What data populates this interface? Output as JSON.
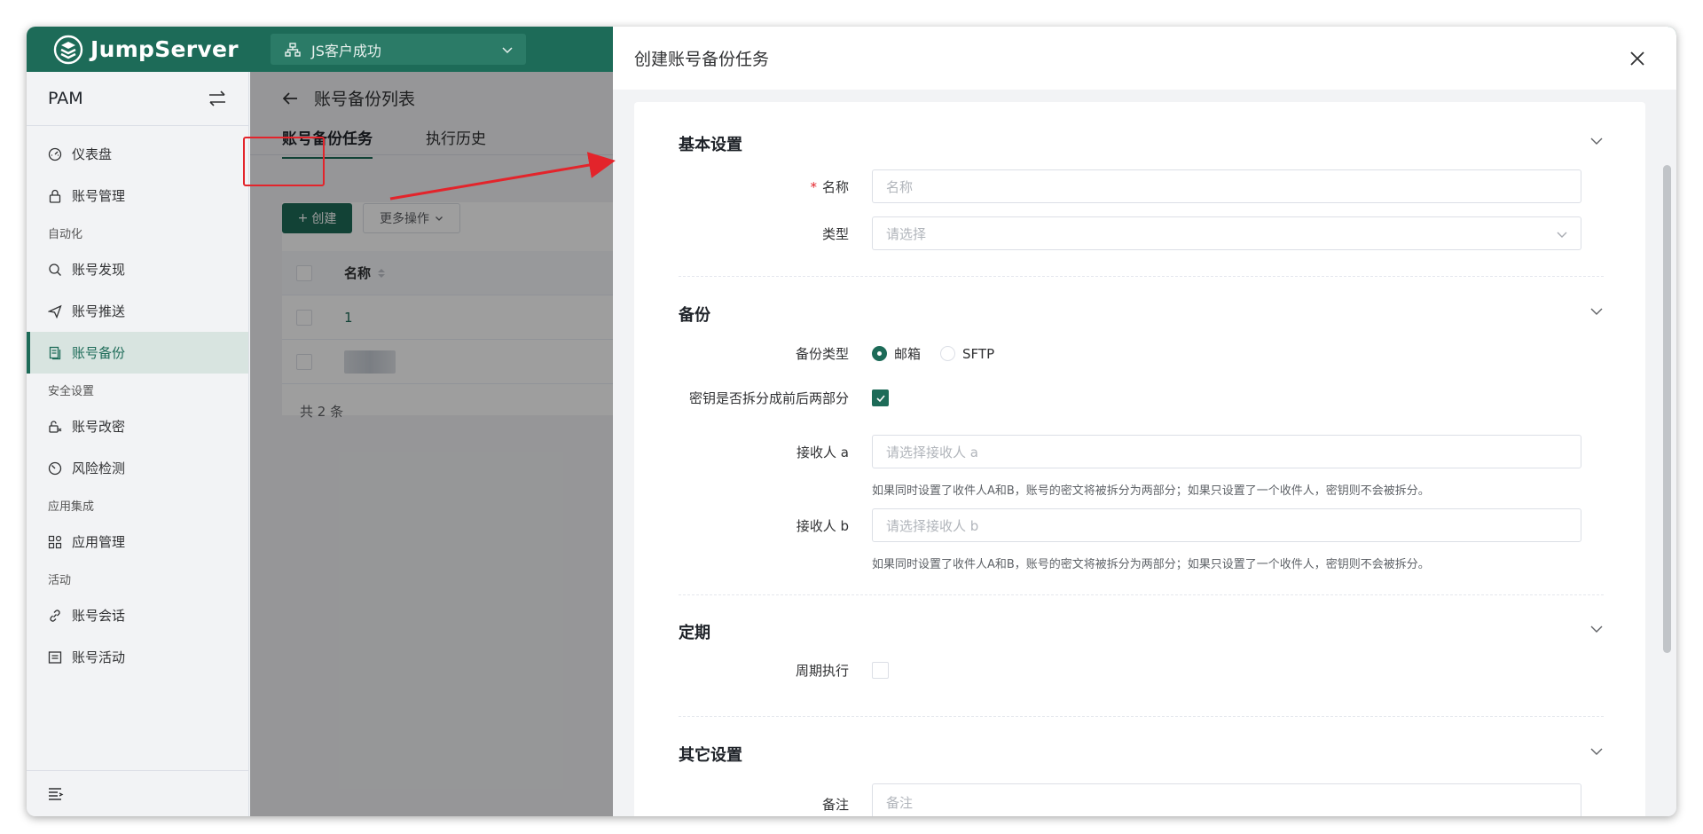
{
  "header": {
    "logo_text": "JumpServer",
    "org_selector": "JS客户成功"
  },
  "sidebar": {
    "title": "PAM",
    "items": [
      {
        "label": "仪表盘",
        "icon": "dashboard-icon"
      },
      {
        "label": "账号管理",
        "icon": "lock-icon"
      }
    ],
    "groups": [
      {
        "title": "自动化",
        "items": [
          {
            "label": "账号发现",
            "icon": "search-icon"
          },
          {
            "label": "账号推送",
            "icon": "send-icon"
          },
          {
            "label": "账号备份",
            "icon": "backup-icon",
            "active": true
          }
        ]
      },
      {
        "title": "安全设置",
        "items": [
          {
            "label": "账号改密",
            "icon": "password-change-icon"
          },
          {
            "label": "风险检测",
            "icon": "risk-detect-icon"
          }
        ]
      },
      {
        "title": "应用集成",
        "items": [
          {
            "label": "应用管理",
            "icon": "apps-icon"
          }
        ]
      },
      {
        "title": "活动",
        "items": [
          {
            "label": "账号会话",
            "icon": "link-icon"
          },
          {
            "label": "账号活动",
            "icon": "activity-icon"
          }
        ]
      }
    ]
  },
  "main": {
    "breadcrumb": "账号备份列表",
    "tabs": [
      {
        "label": "账号备份任务",
        "active": true
      },
      {
        "label": "执行历史",
        "active": false
      }
    ],
    "toolbar": {
      "create_label": "创建",
      "more_label": "更多操作"
    },
    "table": {
      "columns": [
        "名称"
      ],
      "rows": [
        {
          "name": "1"
        },
        {
          "name": "",
          "blurred": true
        }
      ]
    },
    "total": "共 2 条"
  },
  "drawer": {
    "title": "创建账号备份任务",
    "sections": {
      "basic": {
        "title": "基本设置",
        "name_label": "名称",
        "name_placeholder": "名称",
        "type_label": "类型",
        "type_placeholder": "请选择"
      },
      "backup": {
        "title": "备份",
        "backup_type_label": "备份类型",
        "option_email": "邮箱",
        "option_sftp": "SFTP",
        "selected": "邮箱",
        "split_label": "密钥是否拆分成前后两部分",
        "split_checked": true,
        "recipient_a_label": "接收人 a",
        "recipient_a_placeholder": "请选择接收人 a",
        "recipient_a_hint": "如果同时设置了收件人A和B，账号的密文将被拆分为两部分；如果只设置了一个收件人，密钥则不会被拆分。",
        "recipient_b_label": "接收人 b",
        "recipient_b_placeholder": "请选择接收人 b",
        "recipient_b_hint": "如果同时设置了收件人A和B，账号的密文将被拆分为两部分；如果只设置了一个收件人，密钥则不会被拆分。"
      },
      "periodic": {
        "title": "定期",
        "periodic_label": "周期执行",
        "periodic_checked": false
      },
      "other": {
        "title": "其它设置",
        "comment_label": "备注",
        "comment_placeholder": "备注"
      }
    }
  },
  "colors": {
    "brand": "#1d6b58",
    "annotation": "#e3242b"
  }
}
